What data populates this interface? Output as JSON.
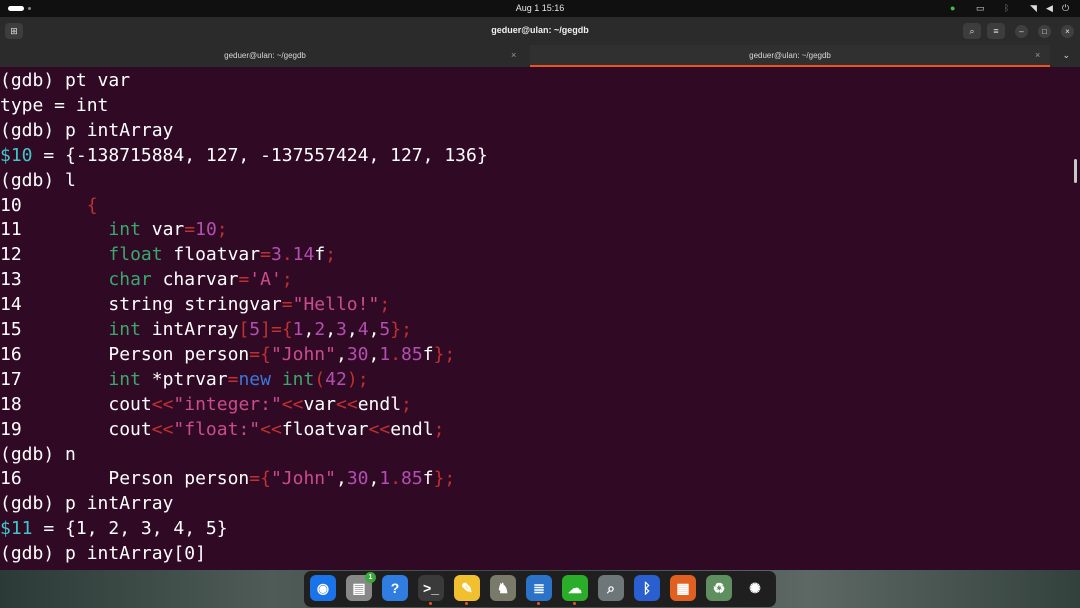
{
  "topbar": {
    "clock": "Aug 1  15:16"
  },
  "window": {
    "title": "geduer@ulan: ~/gegdb",
    "tabs": [
      {
        "label": "geduer@ulan: ~/gegdb",
        "active": false
      },
      {
        "label": "geduer@ulan: ~/gegdb",
        "active": true
      }
    ]
  },
  "terminal": {
    "lines": [
      "(gdb) pt var",
      "type = int",
      "(gdb) p intArray",
      {
        "var": "$10",
        "rest": " = {-138715884, 127, -137557424, 127, 136}"
      },
      "(gdb) l",
      {
        "n": "10",
        "code": "      {"
      },
      {
        "n": "11",
        "code": "        int var=10;"
      },
      {
        "n": "12",
        "code": "        float floatvar=3.14f;"
      },
      {
        "n": "13",
        "code": "        char charvar='A';"
      },
      {
        "n": "14",
        "code": "        string stringvar=\"Hello!\";"
      },
      {
        "n": "15",
        "code": "        int intArray[5]={1,2,3,4,5};"
      },
      {
        "n": "16",
        "code": "        Person person={\"John\",30,1.85f};"
      },
      {
        "n": "17",
        "code": "        int *ptrvar=new int(42);"
      },
      {
        "n": "18",
        "code": "        cout<<\"integer:\"<<var<<endl;"
      },
      {
        "n": "19",
        "code": "        cout<<\"float:\"<<floatvar<<endl;"
      },
      "(gdb) n",
      {
        "n": "16",
        "code": "        Person person={\"John\",30,1.85f};"
      },
      "(gdb) p intArray",
      {
        "var": "$11",
        "rest": " = {1, 2, 3, 4, 5}"
      },
      "(gdb) p intArray[0]"
    ]
  },
  "dock": {
    "apps": [
      {
        "icon": "chrome-icon",
        "color": "#1a73e8",
        "glyph": "◉",
        "running": false
      },
      {
        "icon": "files-icon",
        "color": "#888888",
        "glyph": "▤",
        "badge": "1",
        "running": false
      },
      {
        "icon": "help-icon",
        "color": "#2f7de0",
        "glyph": "?",
        "running": false
      },
      {
        "icon": "terminal-icon",
        "color": "#3a3a3a",
        "glyph": ">_",
        "running": true
      },
      {
        "icon": "text-editor-icon",
        "color": "#f0c030",
        "glyph": "✎",
        "running": true
      },
      {
        "icon": "gimp-icon",
        "color": "#7a7a6a",
        "glyph": "♞",
        "running": false
      },
      {
        "icon": "writer-icon",
        "color": "#2b73c8",
        "glyph": "≣",
        "running": true
      },
      {
        "icon": "wechat-icon",
        "color": "#2aae2a",
        "glyph": "☁",
        "running": true
      },
      {
        "icon": "screenshot-icon",
        "color": "#6d7678",
        "glyph": "⌕",
        "running": false
      },
      {
        "icon": "bluetooth-icon",
        "color": "#2a5fd0",
        "glyph": "ᛒ",
        "running": false
      },
      {
        "icon": "impress-icon",
        "color": "#e06020",
        "glyph": "▦",
        "running": false
      },
      {
        "icon": "trash-icon",
        "color": "#5f8f5f",
        "glyph": "♻",
        "running": false
      },
      {
        "icon": "app-grid-icon",
        "color": "#1f1f1f",
        "glyph": "✺",
        "running": false
      }
    ]
  }
}
